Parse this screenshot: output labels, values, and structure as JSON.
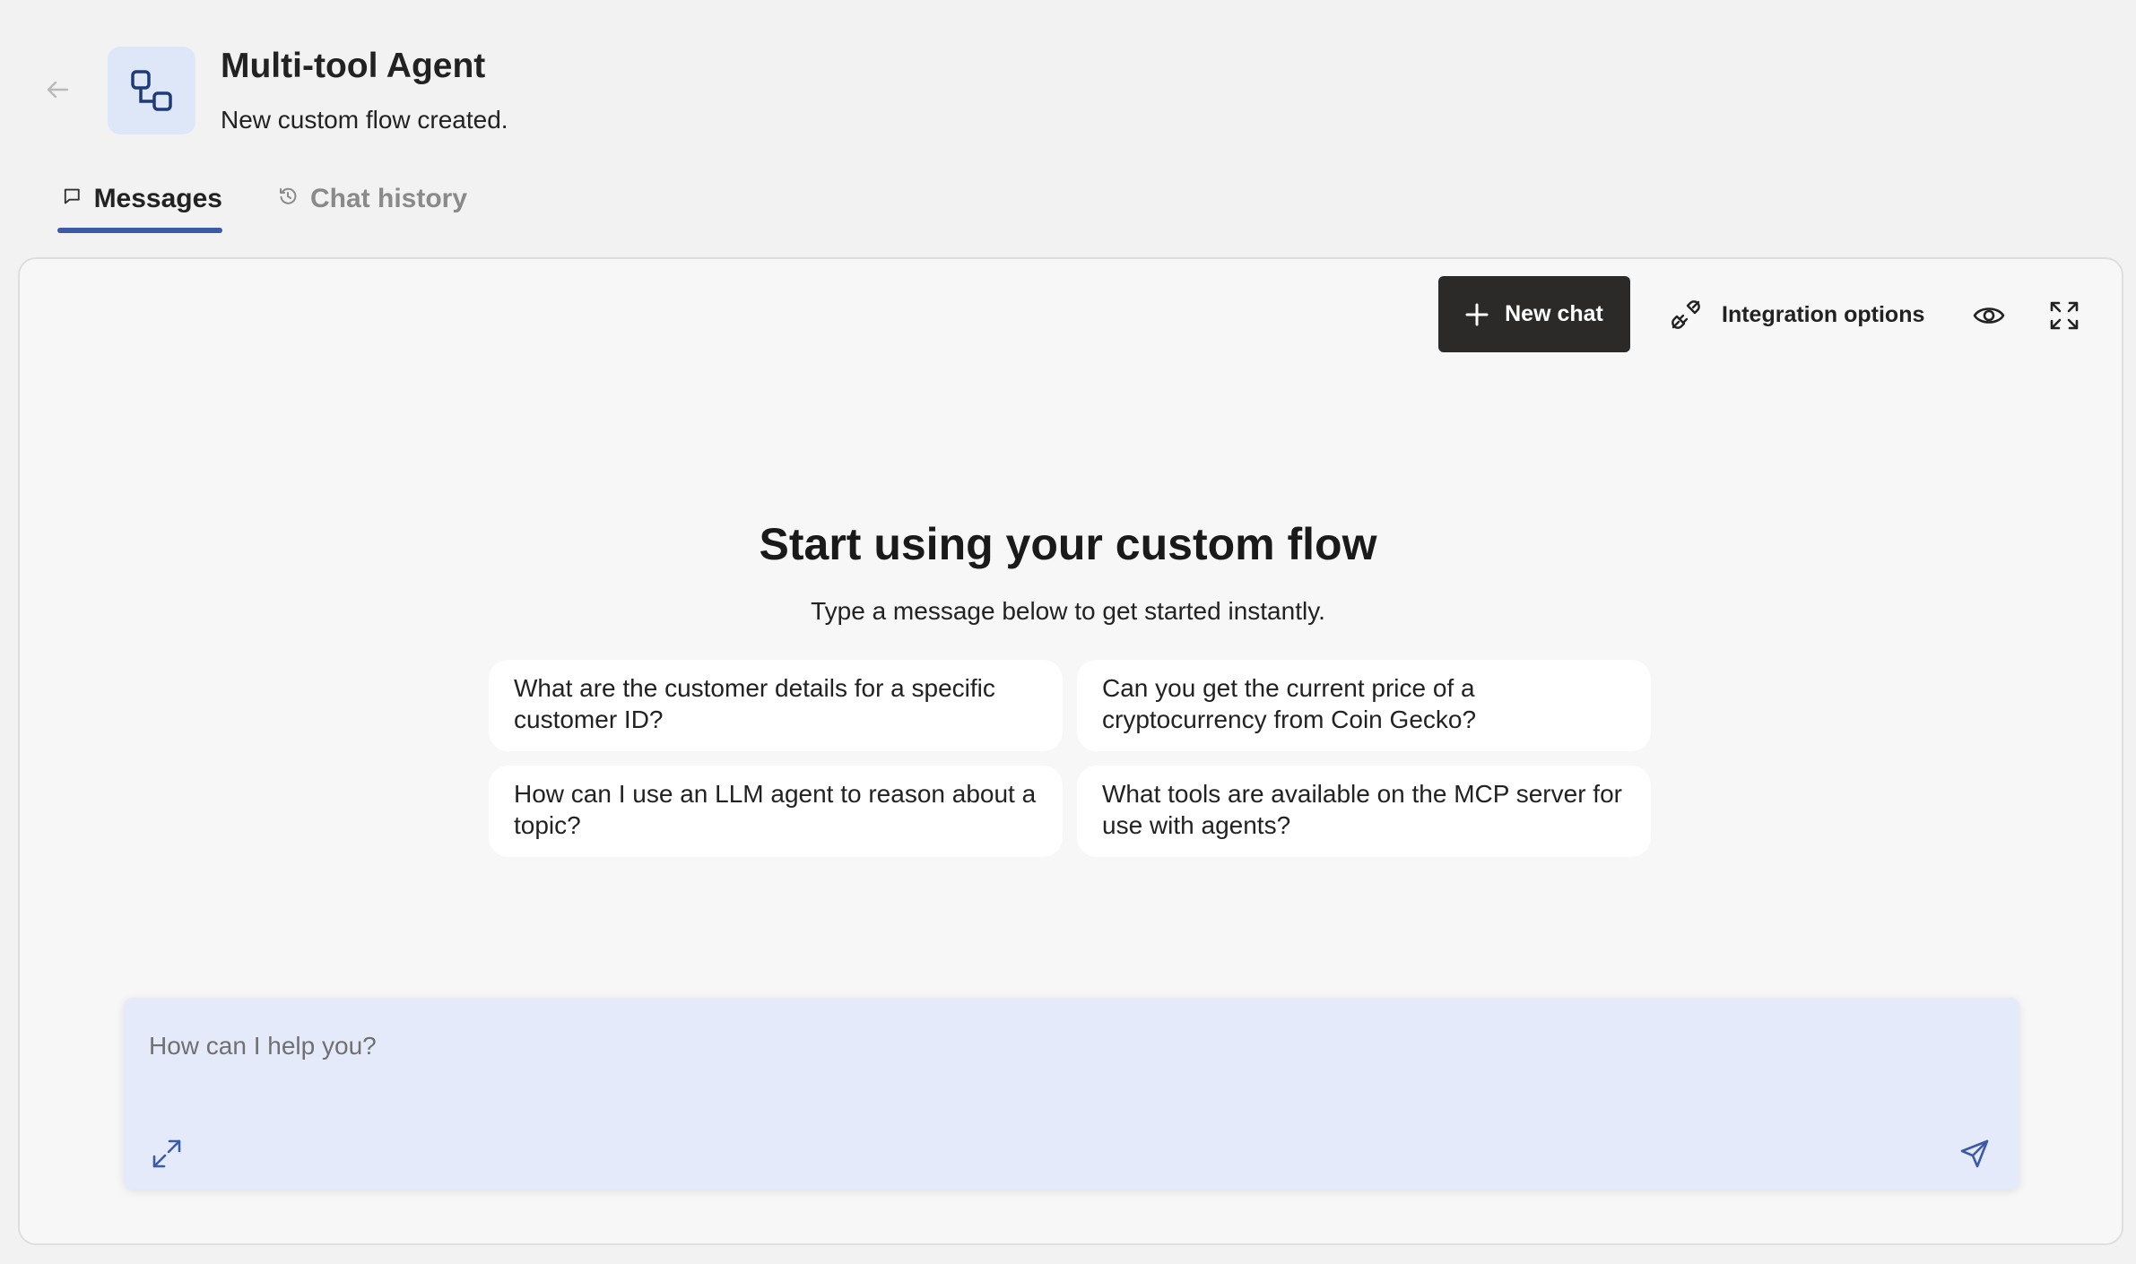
{
  "header": {
    "back_icon": "arrow-left-icon",
    "app_icon": "flow-nodes-icon",
    "title": "Multi-tool Agent",
    "subtitle": "New custom flow created."
  },
  "tabs": [
    {
      "label": "Messages",
      "icon": "message-square-icon",
      "active": true
    },
    {
      "label": "Chat history",
      "icon": "history-icon",
      "active": false
    }
  ],
  "toolbar": {
    "new_chat_label": "New chat",
    "new_chat_icon": "plus-icon",
    "integration_label": "Integration options",
    "integration_icon": "plug-icon",
    "eye_icon": "eye-icon",
    "fullscreen_icon": "fullscreen-icon"
  },
  "main": {
    "title": "Start using your custom flow",
    "subtitle": "Type a message below to get started instantly.",
    "suggestions": [
      "What are the customer details for a specific customer ID?",
      "Can you get the current price of a cryptocurrency from Coin Gecko?",
      "How can I use an LLM agent to reason about a topic?",
      "What tools are available on the MCP server for use with agents?"
    ]
  },
  "input": {
    "placeholder": "How can I help you?",
    "value": "",
    "expand_icon": "expand-icon",
    "send_icon": "send-icon"
  },
  "colors": {
    "accent": "#3b5aa8",
    "new_chat_bg": "#2b2a28",
    "app_icon_bg": "#dde7f8",
    "input_bg": "#e5eafb",
    "page_bg": "#f2f2f2"
  }
}
